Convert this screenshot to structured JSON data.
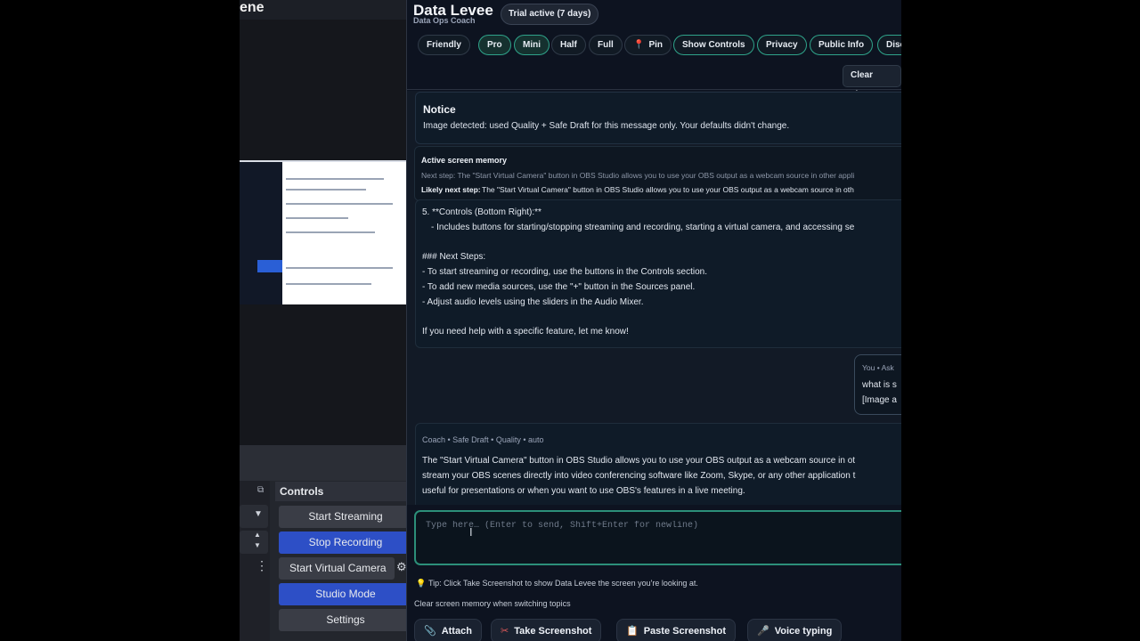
{
  "obs": {
    "scene_title": "ene",
    "controls_header": "Controls",
    "buttons": {
      "start_streaming": "Start Streaming",
      "stop_recording": "Stop Recording",
      "start_virtual_camera": "Start Virtual Camera",
      "studio_mode": "Studio Mode",
      "settings": "Settings"
    },
    "accent": "#2d4fc6"
  },
  "panel": {
    "title": "Data Levee",
    "subtitle": "Data Ops Coach",
    "trial_badge": "Trial active (7 days)",
    "pills": [
      "Friendly",
      "Pro",
      "Mini",
      "Half",
      "Full",
      "Pin",
      "Show Controls",
      "Privacy",
      "Public Info",
      "Disc"
    ],
    "active_pills": [
      "Pro",
      "Mini"
    ],
    "clear_chat": "Clear chat",
    "accent": "#2fa38a"
  },
  "chat": {
    "notice": {
      "title": "Notice",
      "body": "Image detected: used Quality + Safe Draft for this message only. Your defaults didn't change."
    },
    "memory": {
      "title": "Active screen memory",
      "next_step": "Next step: The \"Start Virtual Camera\" button in OBS Studio allows you to use your OBS output as a webcam source in other appli",
      "likely_label": "Likely next step:",
      "likely_text": "The \"Start Virtual Camera\" button in OBS Studio allows you to use your OBS output as a webcam source in oth"
    },
    "coach_message_1": {
      "lines": [
        "5. **Controls (Bottom Right):**",
        "   - Includes buttons for starting/stopping streaming and recording, starting a virtual camera, and accessing se",
        "",
        "### Next Steps:",
        "- To start streaming or recording, use the buttons in the Controls section.",
        "- To add new media sources, use the \"+\" button in the Sources panel.",
        "- Adjust audio levels using the sliders in the Audio Mixer.",
        "",
        "If you need help with a specific feature, let me know!"
      ]
    },
    "user_message": {
      "meta": "You  • Ask",
      "line1": "what is s",
      "line2": "[Image a"
    },
    "coach_message_2": {
      "meta": "Coach  • Safe Draft • Quality • auto",
      "lines": [
        "The \"Start Virtual Camera\" button in OBS Studio allows you to use your OBS output as a webcam source in ot",
        "stream your OBS scenes directly into video conferencing software like Zoom, Skype, or any other application t",
        "useful for presentations or when you want to use OBS's features in a live meeting."
      ]
    }
  },
  "composer": {
    "placeholder": "Type here… (Enter to send, Shift+Enter for newline)",
    "value": ""
  },
  "tip": "Tip: Click Take Screenshot to show Data Levee the screen you're looking at.",
  "clear_memory": "Clear screen memory when switching topics",
  "actions": {
    "attach": "Attach",
    "take_screenshot": "Take Screenshot",
    "paste_screenshot": "Paste Screenshot",
    "voice_typing": "Voice typing"
  },
  "icons": {
    "pin": "pin-icon",
    "attach": "paperclip-icon",
    "take_screenshot": "scissors-icon",
    "paste_screenshot": "clipboard-icon",
    "voice_typing": "microphone-icon",
    "tip": "lightbulb-icon"
  }
}
